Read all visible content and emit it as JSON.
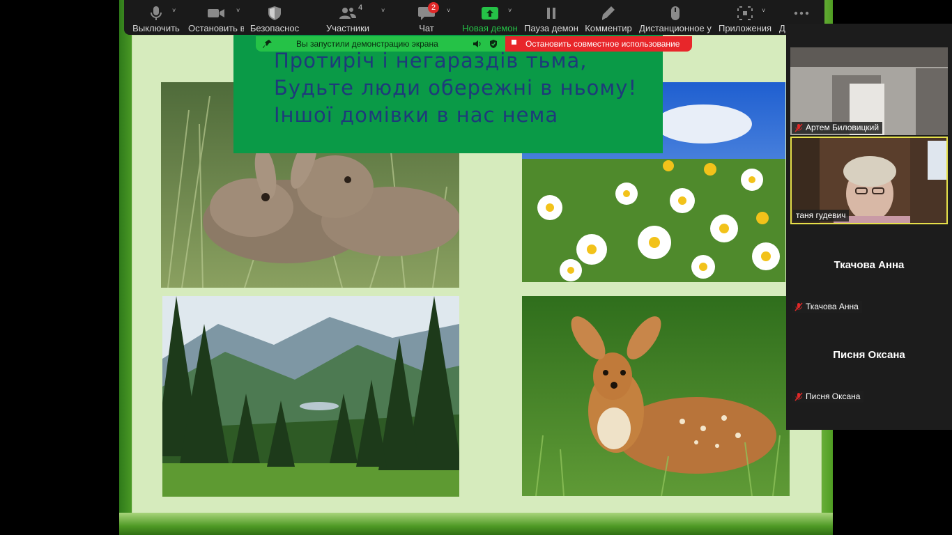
{
  "toolbar": {
    "items": [
      {
        "label": "Выключить",
        "icon": "microphone-icon"
      },
      {
        "label": "Остановить в",
        "icon": "video-camera-icon"
      },
      {
        "label": "Безопаснос",
        "icon": "shield-icon"
      },
      {
        "label": "Участники",
        "icon": "participants-icon",
        "count": "4"
      },
      {
        "label": "Чат",
        "icon": "chat-icon",
        "badge": "2"
      },
      {
        "label": "Новая демон",
        "icon": "share-screen-icon"
      },
      {
        "label": "Пауза демон",
        "icon": "pause-icon"
      },
      {
        "label": "Комментир",
        "icon": "annotate-pencil-icon"
      },
      {
        "label": "Дистанционное у",
        "icon": "mouse-icon"
      },
      {
        "label": "Приложения",
        "icon": "apps-icon"
      },
      {
        "label": "Д",
        "icon": "more-icon"
      }
    ]
  },
  "share_banner": {
    "text": "Вы запустили демонстрацию экрана",
    "stop_label": "Остановить совместное использование"
  },
  "slide": {
    "poem": [
      "Протиріч і негараздів тьма,",
      "Будьте люди обережні в ньому!",
      "Іншої домівки в нас нема"
    ],
    "photos": [
      "rabbits-photo",
      "daisies-photo",
      "mountain-forest-photo",
      "fawn-photo"
    ]
  },
  "participants": [
    {
      "name": "Артем Биловицкий",
      "muted": true,
      "video": true
    },
    {
      "name": "таня гудевич",
      "muted": false,
      "video": true,
      "active_speaker": true
    },
    {
      "name": "Ткачова Анна",
      "muted": true,
      "video": false
    },
    {
      "name": "Писня Оксана",
      "muted": true,
      "video": false
    }
  ],
  "colors": {
    "share_green": "#25c247",
    "stop_red": "#e8262a",
    "speaker_border": "#e6e04a",
    "poem_text": "#1e3a7a",
    "text_box": "#0a9a47"
  }
}
